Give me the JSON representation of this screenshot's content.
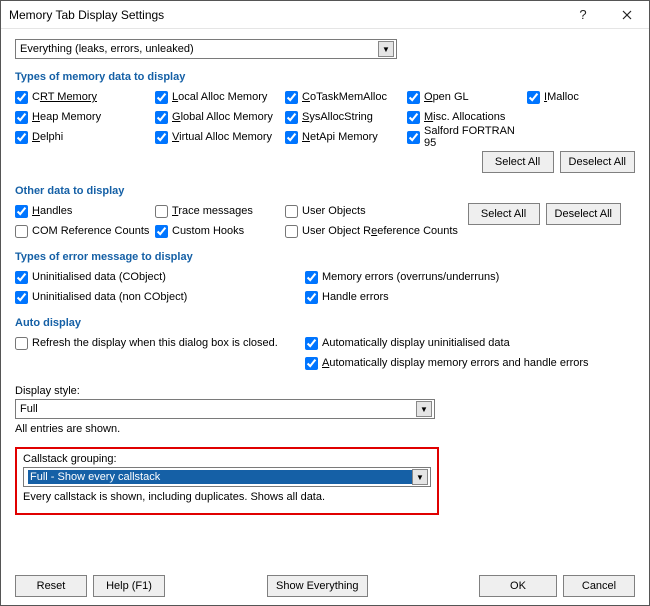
{
  "title": "Memory Tab Display Settings",
  "main_filter": "Everything (leaks, errors, unleaked)",
  "sections": {
    "types_memory": "Types of memory data to display",
    "other_data": "Other data to display",
    "error_types": "Types of error message to display",
    "auto_display": "Auto display"
  },
  "chk": {
    "crt": "RT Memory",
    "heap": "H",
    "heap2": "eap Memory",
    "delphi": "D",
    "delphi2": "elphi",
    "local": "ocal Alloc Memory",
    "global": "lobal Alloc Memory",
    "virtual": "irtual Alloc Memory",
    "cotask": "C",
    "cotask2": "oTaskMemAlloc",
    "sysalloc": "S",
    "sysalloc2": "ysAllocString",
    "netapi": "N",
    "netapi2": "etApi Memory",
    "opengl": "O",
    "opengl2": "pen GL",
    "misc": "M",
    "misc2": "isc. Allocations",
    "salford": "Salford FORTRAN 95",
    "imalloc": "I",
    "imalloc2": "Malloc",
    "handles": "H",
    "handles2": "andles",
    "comref": "COM Reference Counts",
    "trace": "T",
    "trace2": "race messages",
    "customhooks": "Custom Hooks",
    "userobj": "User Objects",
    "userobjref": "User Object R",
    "userobjref2": "eference Counts",
    "uninit_cobj": "Uninitialised data (CObject)",
    "uninit_noncobj": "Uninitialised data (non CObject)",
    "memerrors": "Memory errors (overruns/underruns)",
    "handleerrors": "Handle errors",
    "refresh": "Refresh the display when this dialog box is closed.",
    "auto_uninit": "Automatically display uninitialised data",
    "auto_memerr": "utomatically display memory errors and handle errors"
  },
  "display_style_label": "isplay style:",
  "display_style_value": "Full",
  "all_entries": "All entries are shown.",
  "callstack_label": "allstack grouping:",
  "callstack_value": "Full - Show every callstack",
  "callstack_desc": "Every callstack is shown, including duplicates. Shows all data.",
  "buttons": {
    "select_all": "Select All",
    "deselect_all": "Deselect All",
    "reset": "Reset",
    "help": "Help (F1)",
    "show_everything": "Show Everything",
    "ok": "OK",
    "cancel": "Cancel"
  }
}
